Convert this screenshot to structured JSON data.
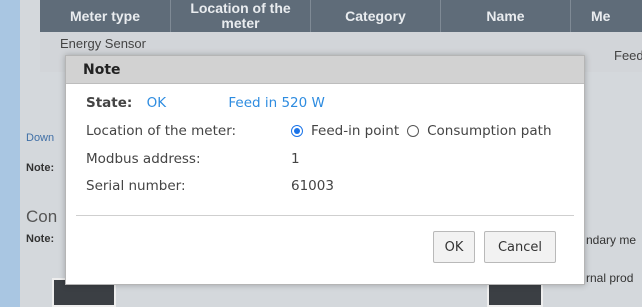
{
  "background": {
    "table_headers": [
      "Meter type",
      "Location of the meter",
      "Category",
      "Name",
      "Me"
    ],
    "row": {
      "meter_type": "Energy Sensor",
      "location": "Feed"
    },
    "link_text": "Down",
    "note1": "Note: ",
    "heading": "Con",
    "note2": "Note:",
    "right_text1": "ndary me",
    "right_text2": "rnal prod"
  },
  "dialog": {
    "title": "Note",
    "state_label": "State:",
    "state_value": "OK",
    "state_feed": "Feed in 520 W",
    "location_label": "Location of the meter:",
    "location_options": [
      "Feed-in point",
      "Consumption path"
    ],
    "location_selected": "Feed-in point",
    "modbus_label": "Modbus address:",
    "modbus_value": "1",
    "serial_label": "Serial number:",
    "serial_value": "61003",
    "ok_label": "OK",
    "cancel_label": "Cancel"
  },
  "colors": {
    "accent": "#2e8ce0",
    "radio": "#1a73e8",
    "header_bg": "#5f6c79"
  }
}
